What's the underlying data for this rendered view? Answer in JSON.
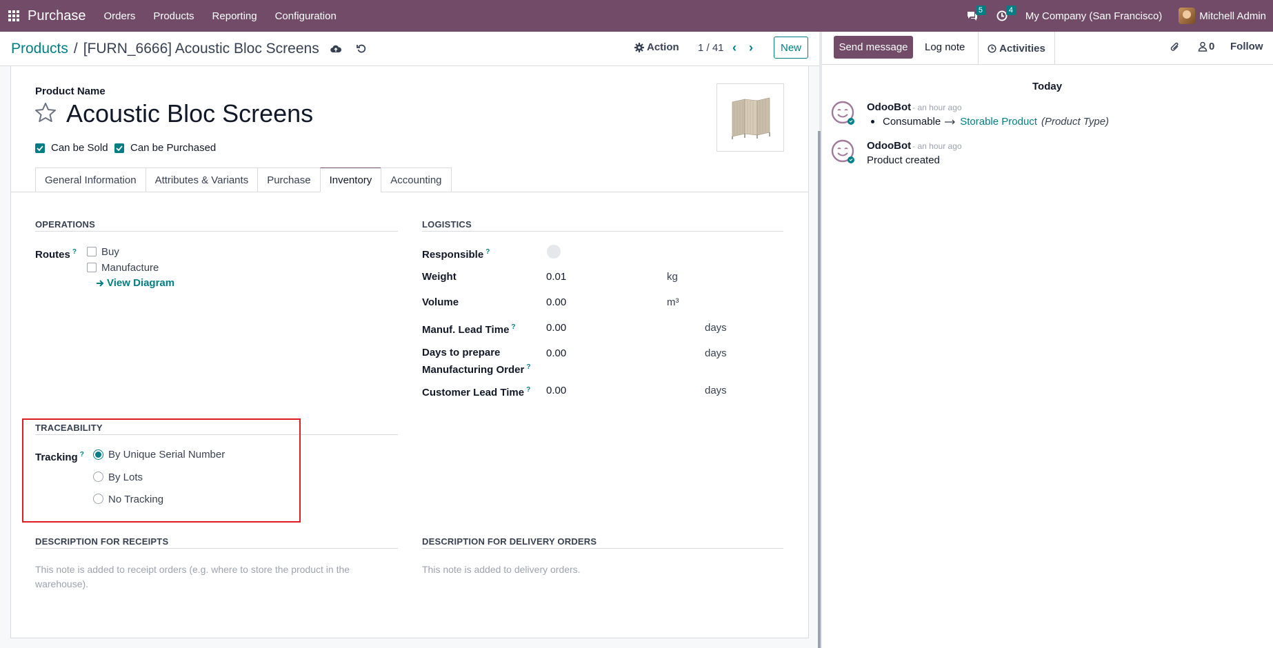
{
  "navbar": {
    "app_name": "Purchase",
    "menu": [
      "Orders",
      "Products",
      "Reporting",
      "Configuration"
    ],
    "messages_count": "5",
    "activities_count": "4",
    "company": "My Company (San Francisco)",
    "user": "Mitchell Admin"
  },
  "breadcrumb": {
    "root": "Products",
    "separator": "/",
    "current": "[FURN_6666] Acoustic Bloc Screens"
  },
  "control": {
    "action_label": "Action",
    "pager": "1 / 41",
    "new_label": "New"
  },
  "form": {
    "product_name_label": "Product Name",
    "product_name": "Acoustic Bloc Screens",
    "can_be_sold": "Can be Sold",
    "can_be_purchased": "Can be Purchased",
    "tabs": [
      "General Information",
      "Attributes & Variants",
      "Purchase",
      "Inventory",
      "Accounting"
    ],
    "active_tab": "Inventory"
  },
  "operations": {
    "title": "OPERATIONS",
    "routes_label": "Routes",
    "routes": [
      "Buy",
      "Manufacture"
    ],
    "view_diagram": "View Diagram"
  },
  "logistics": {
    "title": "LOGISTICS",
    "responsible_label": "Responsible",
    "weight_label": "Weight",
    "weight_value": "0.01",
    "weight_unit": "kg",
    "volume_label": "Volume",
    "volume_value": "0.00",
    "volume_unit": "m³",
    "manuf_lead_label": "Manuf. Lead Time",
    "manuf_lead_value": "0.00",
    "manuf_lead_unit": "days",
    "days_prepare_label": "Days to prepare Manufacturing Order",
    "days_prepare_value": "0.00",
    "days_prepare_unit": "days",
    "customer_lead_label": "Customer Lead Time",
    "customer_lead_value": "0.00",
    "customer_lead_unit": "days"
  },
  "traceability": {
    "title": "TRACEABILITY",
    "tracking_label": "Tracking",
    "options": [
      "By Unique Serial Number",
      "By Lots",
      "No Tracking"
    ],
    "selected": "By Unique Serial Number"
  },
  "descriptions": {
    "receipts_title": "DESCRIPTION FOR RECEIPTS",
    "receipts_placeholder": "This note is added to receipt orders (e.g. where to store the product in the warehouse).",
    "delivery_title": "DESCRIPTION FOR DELIVERY ORDERS",
    "delivery_placeholder": "This note is added to delivery orders."
  },
  "chatter": {
    "send_message": "Send message",
    "log_note": "Log note",
    "activities": "Activities",
    "followers_count": "0",
    "follow": "Follow",
    "date_separator": "Today",
    "messages": [
      {
        "author": "OdooBot",
        "time": "- an hour ago",
        "old": "Consumable",
        "new": "Storable Product",
        "field": "(Product Type)"
      },
      {
        "author": "OdooBot",
        "time": "- an hour ago",
        "body": "Product created"
      }
    ]
  },
  "colors": {
    "brand": "#714B67",
    "accent": "#017E84",
    "highlight": "#e01b24"
  }
}
